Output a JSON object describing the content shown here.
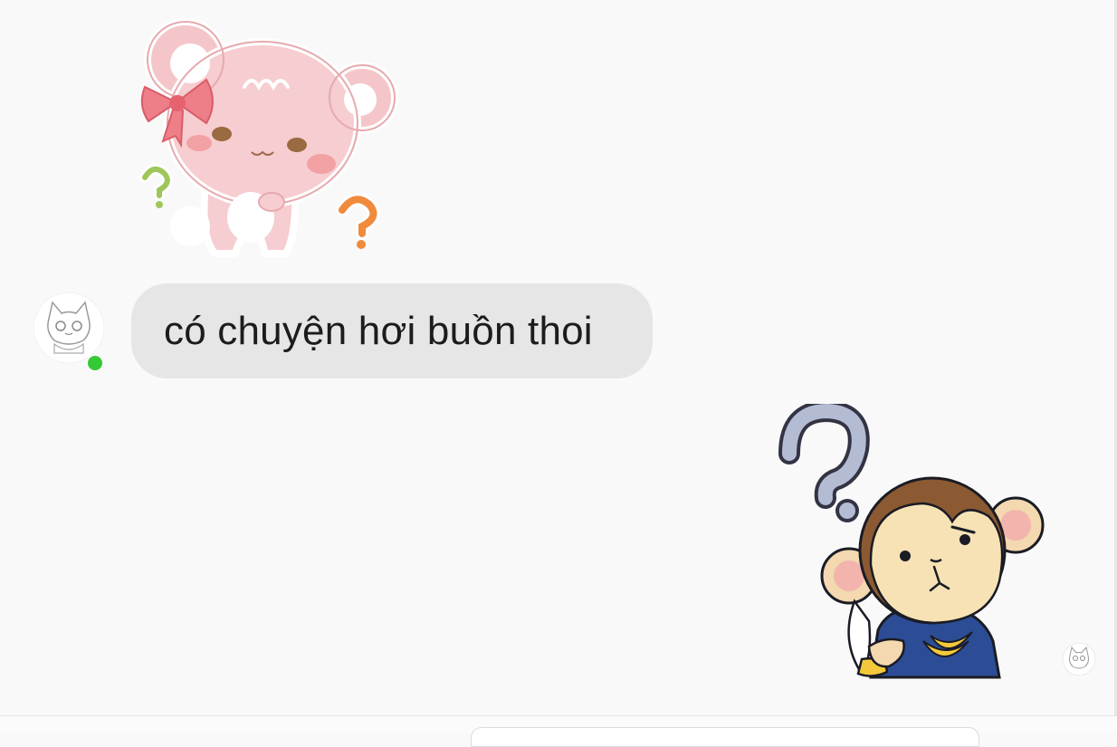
{
  "conversation": {
    "messages": [
      {
        "sender": "contact",
        "kind": "sticker",
        "sticker": "pink-bear-confused-sticker"
      },
      {
        "sender": "contact",
        "kind": "text",
        "text": "có chuyện hơi buồn thoi"
      },
      {
        "sender": "self",
        "kind": "sticker",
        "sticker": "monkey-banana-question-sticker"
      }
    ]
  },
  "contact": {
    "online": true,
    "avatar": "cat-sketch-avatar",
    "status_color": "#34c935"
  },
  "colors": {
    "background": "#f9f9f9",
    "incoming_bubble": "#e6e6e6",
    "text": "#1c1c1c"
  }
}
